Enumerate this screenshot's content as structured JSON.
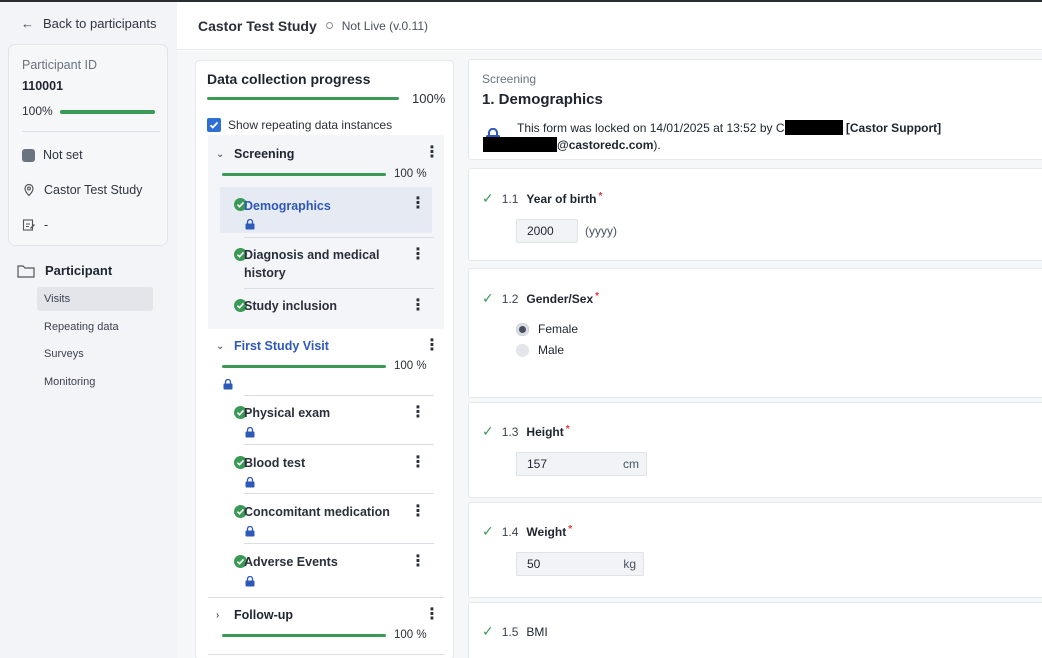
{
  "sidebar": {
    "back_label": "Back to participants",
    "participant": {
      "id_label": "Participant ID",
      "id_value": "110001",
      "progress_text": "100%",
      "progress": 1.0,
      "status": "Not set",
      "study": "Castor Test Study",
      "extra": "-"
    },
    "nav": {
      "heading": "Participant",
      "items": [
        "Visits",
        "Repeating data",
        "Surveys",
        "Monitoring"
      ]
    }
  },
  "header": {
    "study_title": "Castor Test Study",
    "status": "Not Live (v.0.11)"
  },
  "progress_panel": {
    "title": "Data collection progress",
    "overall_text": "100%",
    "show_repeating_label": "Show repeating data instances",
    "sections": [
      {
        "name": "Screening",
        "percent_text": "100 %",
        "items": [
          "Demographics",
          "Diagnosis and medical history",
          "Study inclusion"
        ]
      },
      {
        "name": "First Study Visit",
        "percent_text": "100 %",
        "items": [
          "Physical exam",
          "Blood test",
          "Concomitant medication",
          "Adverse Events"
        ]
      },
      {
        "name": "Follow-up",
        "percent_text": "100 %",
        "items": []
      }
    ]
  },
  "form": {
    "breadcrumb": "Screening",
    "title": "1. Demographics",
    "lock_text_1": "This form was locked on 14/01/2025 at 13:52 by C",
    "lock_text_2": "[Castor Support]",
    "lock_text_3": "@castoredc.com",
    "lock_text_end": ").",
    "questions": [
      {
        "number": "1.1",
        "label": "Year of birth",
        "value": "2000",
        "hint": "(yyyy)"
      },
      {
        "number": "1.2",
        "label": "Gender/Sex",
        "options": [
          "Female",
          "Male"
        ],
        "selected": "Female"
      },
      {
        "number": "1.3",
        "label": "Height",
        "value": "157",
        "unit": "cm"
      },
      {
        "number": "1.4",
        "label": "Weight",
        "value": "50",
        "unit": "kg"
      },
      {
        "number": "1.5",
        "label": "BMI"
      }
    ]
  },
  "colors": {
    "accent_green": "#3a9a55",
    "link_blue": "#2d59b8",
    "required_red": "#e0393e"
  }
}
